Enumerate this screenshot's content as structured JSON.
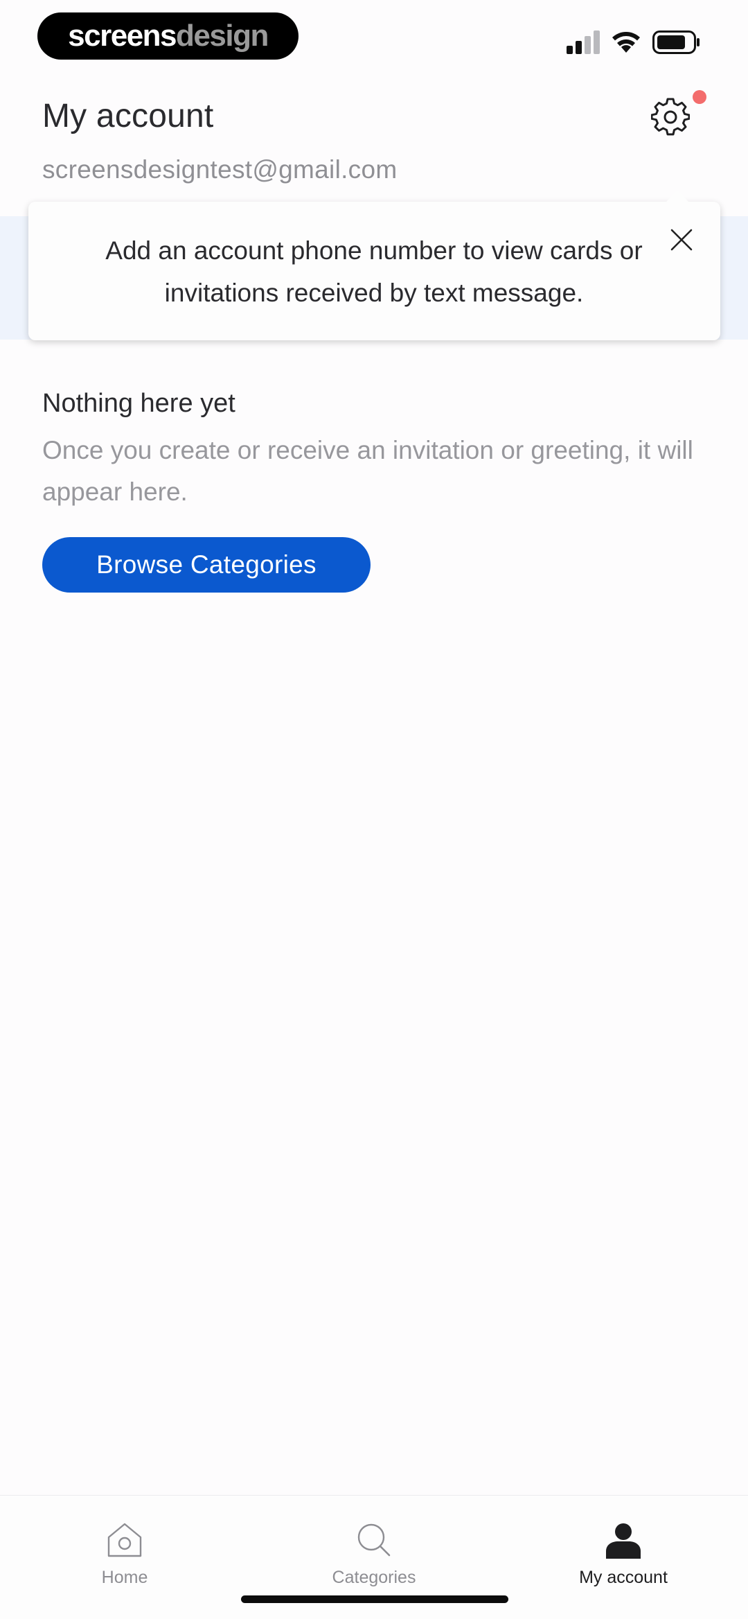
{
  "status_bar": {
    "brand_part1": "screens",
    "brand_part2": "design"
  },
  "header": {
    "title": "My account",
    "email": "screensdesigntest@gmail.com",
    "settings_icon": "gear-icon",
    "notification_dot_color": "#f36c6c"
  },
  "tooltip": {
    "message": "Add an account phone number to view cards or invitations received by text message.",
    "close_icon": "close-icon"
  },
  "empty_state": {
    "title": "Nothing here yet",
    "body": "Once you create or receive an invitation or greeting, it will appear here.",
    "button_label": "Browse Categories",
    "button_color": "#0b59cf"
  },
  "tab_bar": {
    "tabs": [
      {
        "label": "Home",
        "icon": "home-icon",
        "active": false
      },
      {
        "label": "Categories",
        "icon": "search-icon",
        "active": false
      },
      {
        "label": "My account",
        "icon": "person-icon",
        "active": true
      }
    ]
  }
}
